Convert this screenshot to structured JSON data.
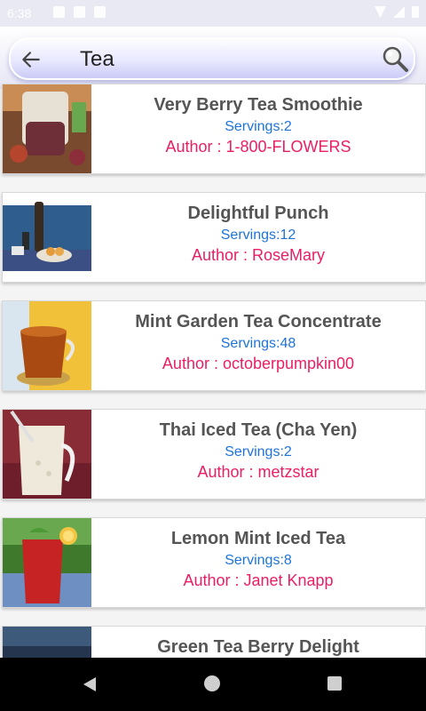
{
  "status_bar": {
    "time": "6:38"
  },
  "search": {
    "query": "Tea"
  },
  "recipes": [
    {
      "title": "Very Berry Tea Smoothie",
      "servings": "Servings:2",
      "author": "Author : 1-800-FLOWERS",
      "image": "berry-smoothie-photo"
    },
    {
      "title": "Delightful Punch",
      "servings": "Servings:12",
      "author": "Author : RoseMary",
      "image": "punch-photo"
    },
    {
      "title": "Mint Garden Tea Concentrate",
      "servings": "Servings:48",
      "author": "Author : octoberpumpkin00",
      "image": "tea-concentrate-photo"
    },
    {
      "title": "Thai Iced Tea (Cha Yen)",
      "servings": "Servings:2",
      "author": "Author : metzstar",
      "image": "thai-iced-tea-photo"
    },
    {
      "title": "Lemon Mint Iced Tea",
      "servings": "Servings:8",
      "author": "Author : Janet Knapp",
      "image": "lemon-iced-tea-photo"
    },
    {
      "title": "Green Tea Berry Delight",
      "servings": "",
      "author": "",
      "image": "green-tea-photo"
    }
  ],
  "colors": {
    "title": "#555555",
    "servings": "#1e73d8",
    "author": "#e91e63"
  }
}
